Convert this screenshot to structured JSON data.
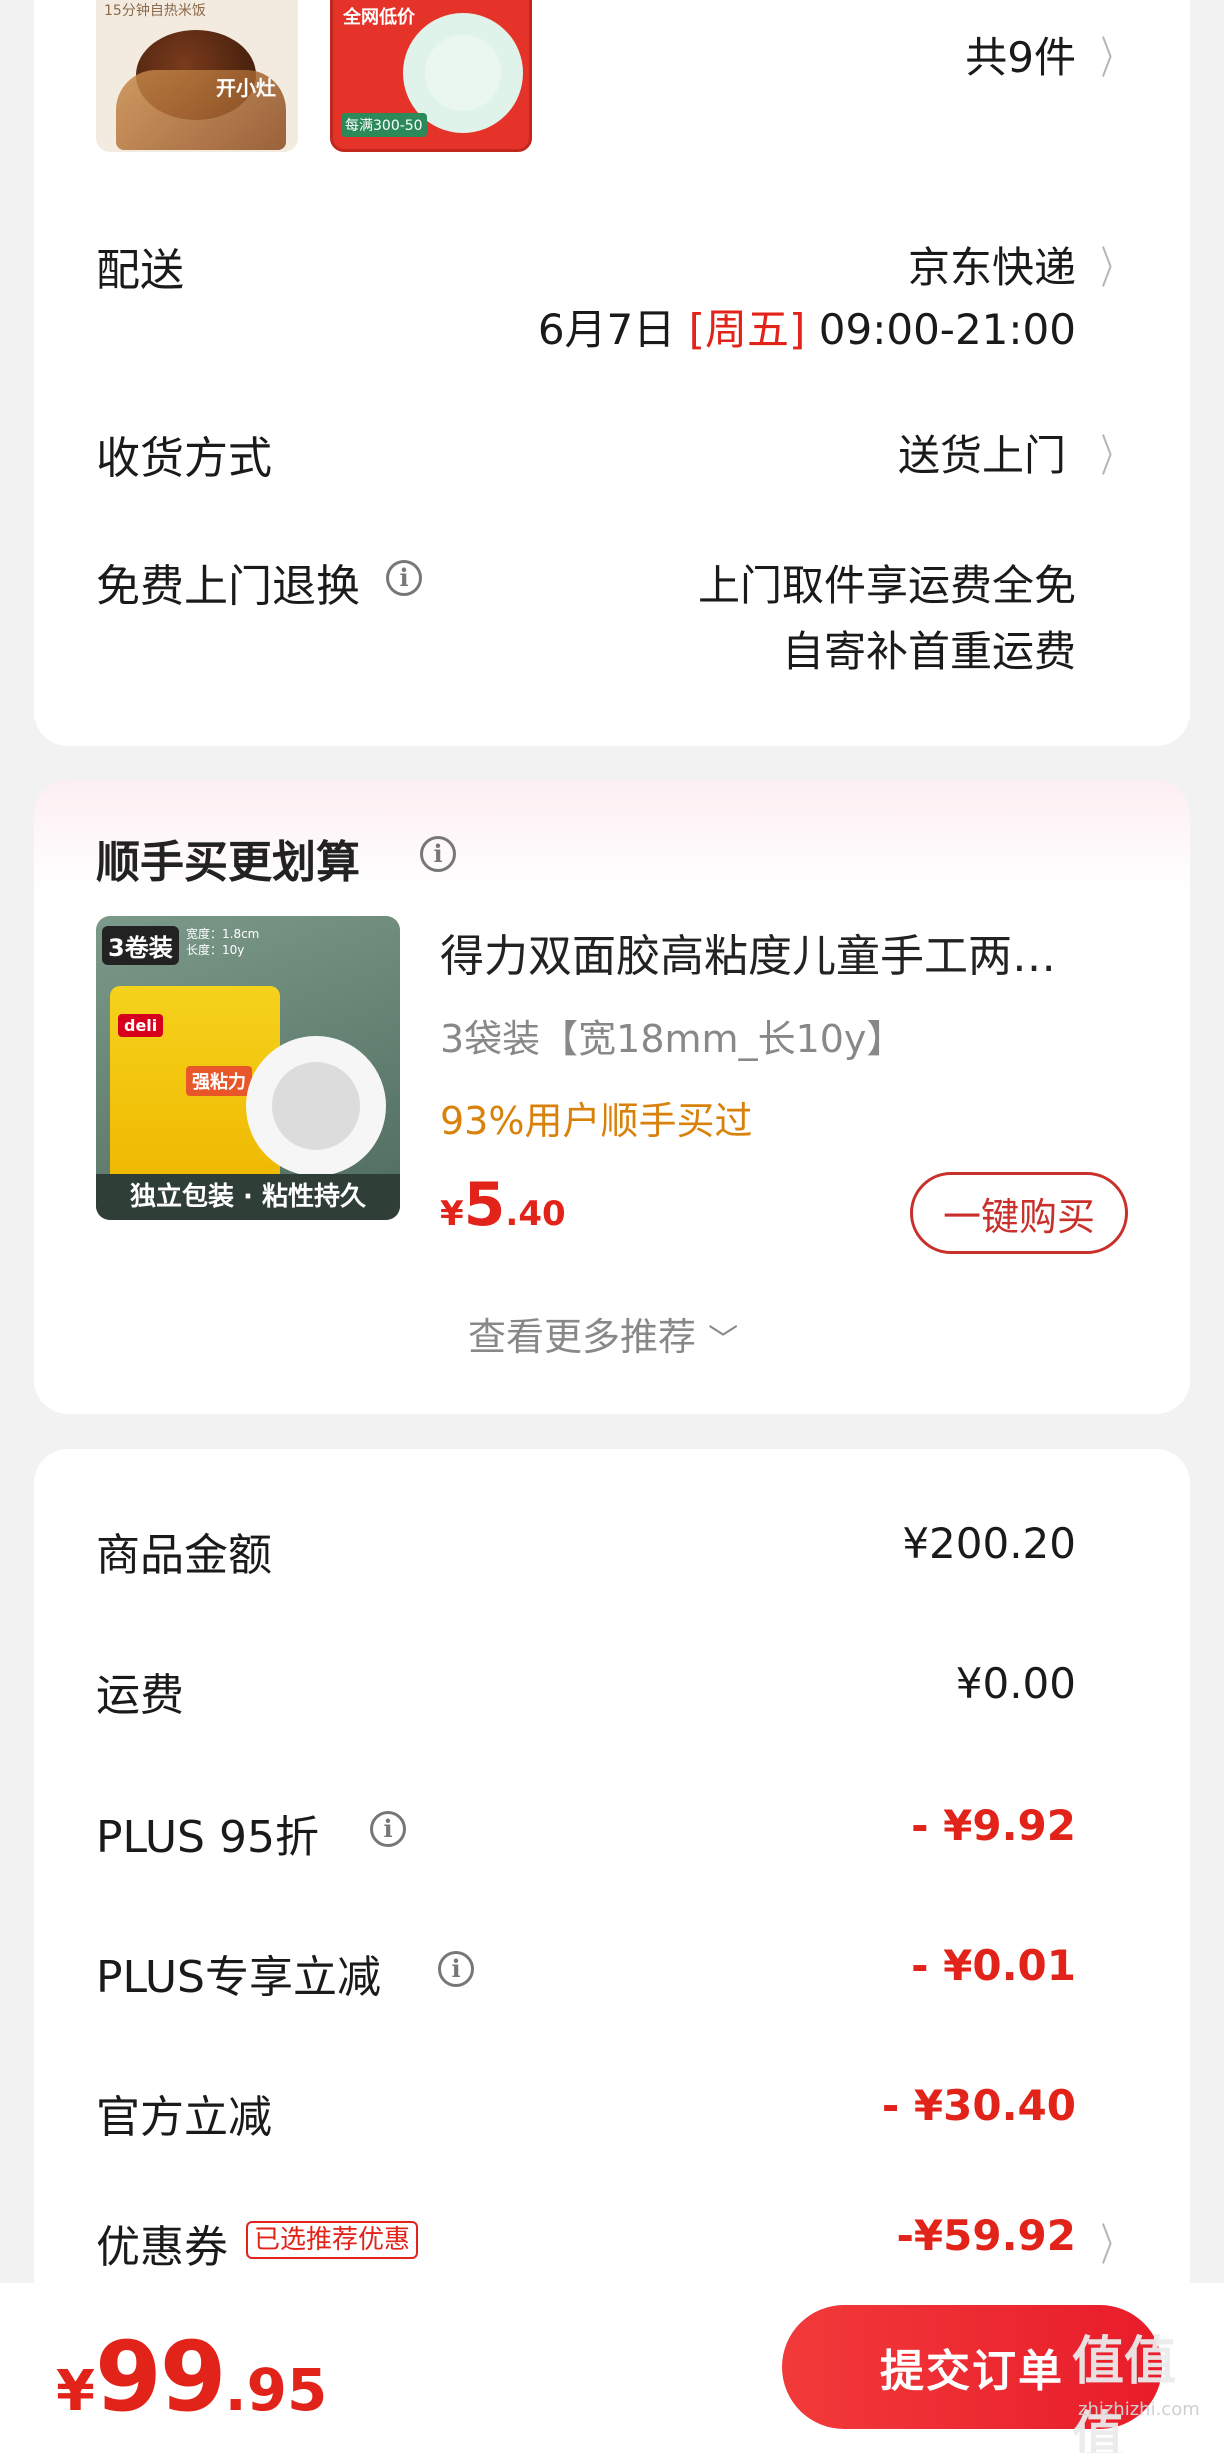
{
  "items": {
    "count_label": "共9件",
    "thumb1_brand": "开小灶",
    "thumb1_caption": "15分钟自热米饭",
    "thumb2_badge": "全网低价",
    "thumb2_caption": "每满300-50"
  },
  "delivery": {
    "label": "配送",
    "carrier": "京东快递",
    "date": "6月7日",
    "weekday": "[周五]",
    "time": "09:00-21:00"
  },
  "receive": {
    "label": "收货方式",
    "value": "送货上门"
  },
  "free_return": {
    "label": "免费上门退换",
    "line1": "上门取件享运费全免",
    "line2": "自寄补首重运费"
  },
  "recommend": {
    "title": "顺手买更划算",
    "product_title": "得力双面胶高粘度儿童手工两…",
    "spec": "3袋装【宽18mm_长10y】",
    "buy_rate": "93%用户顺手买过",
    "price_symbol": "¥",
    "price_int": "5",
    "price_dec": ".40",
    "buy_button": "一键购买",
    "more": "查看更多推荐",
    "img_tag": "3卷装",
    "img_spec1": "宽度：1.8cm",
    "img_spec2": "长度：10y",
    "img_brand": "deli",
    "img_sticker": "强粘力",
    "img_footer": "独立包装 · 粘性持久"
  },
  "summary": {
    "rows": [
      {
        "label": "商品金额",
        "value": "¥200.20"
      },
      {
        "label": "运费",
        "value": "¥0.00"
      },
      {
        "label": "PLUS 95折",
        "value": "- ¥9.92"
      },
      {
        "label": "PLUS专享立减",
        "value": "- ¥0.01"
      },
      {
        "label": "官方立减",
        "value": "- ¥30.40"
      },
      {
        "label": "优惠券",
        "value": "-¥59.92"
      }
    ],
    "coupon_tag": "已选推荐优惠"
  },
  "footer": {
    "currency": "¥",
    "total_int": "99",
    "total_dec": ".95",
    "submit": "提交订单",
    "watermark_cn": "值值值",
    "watermark_en": "zhizhizhi.com"
  },
  "colors": {
    "accent": "#e2231a",
    "price_orange": "#d9820b",
    "background": "#f2f2f2"
  }
}
